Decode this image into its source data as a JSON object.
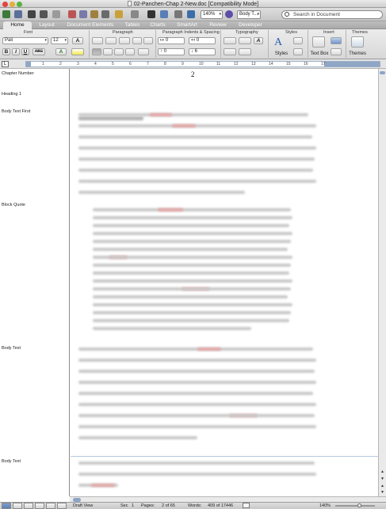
{
  "window": {
    "title": "02-Panchen-Chap 2-New.doc [Compatibility Mode]"
  },
  "toolbar": {
    "zoom": "140%",
    "style_box": "Body T...",
    "search_placeholder": "Search in Document"
  },
  "tabs": [
    "Home",
    "Layout",
    "Document Elements",
    "Tables",
    "Charts",
    "SmartArt",
    "Review",
    "Developer"
  ],
  "ribbon": {
    "groups": [
      "Font",
      "Paragraph",
      "Paragraph Indents & Spacing",
      "Typography",
      "Styles",
      "Insert",
      "Themes"
    ],
    "font_name": "Pali",
    "font_size": "12",
    "indent_left": "0",
    "indent_right": "0",
    "space_before": "0",
    "space_after": "6",
    "styles_label": "Styles",
    "textbox_label": "Text Box",
    "themes_label": "Themes",
    "format_buttons": [
      "B",
      "I",
      "U",
      "ABC"
    ]
  },
  "ruler": {
    "numbers": [
      "1",
      "2",
      "3",
      "4",
      "5",
      "6",
      "7",
      "8",
      "9",
      "10",
      "11",
      "12",
      "13",
      "14",
      "15",
      "16",
      "17"
    ]
  },
  "style_area": [
    {
      "name": "Chapter Number"
    },
    {
      "name": "Heading 1"
    },
    {
      "name": "Body Text First"
    },
    {
      "name": "Block Quote"
    },
    {
      "name": "Body Text"
    },
    {
      "name": "Body Text"
    }
  ],
  "document": {
    "page_number": "2"
  },
  "status": {
    "view": "Draft View",
    "sec_label": "Sec",
    "sec_value": "1",
    "pages_label": "Pages:",
    "pages_value": "2 of 65",
    "words_label": "Words:",
    "words_value": "409 of 17446",
    "zoom": "140%"
  },
  "colors": {
    "accent": "#5a7fb6",
    "ruler_margin": "#8fa6c5"
  }
}
